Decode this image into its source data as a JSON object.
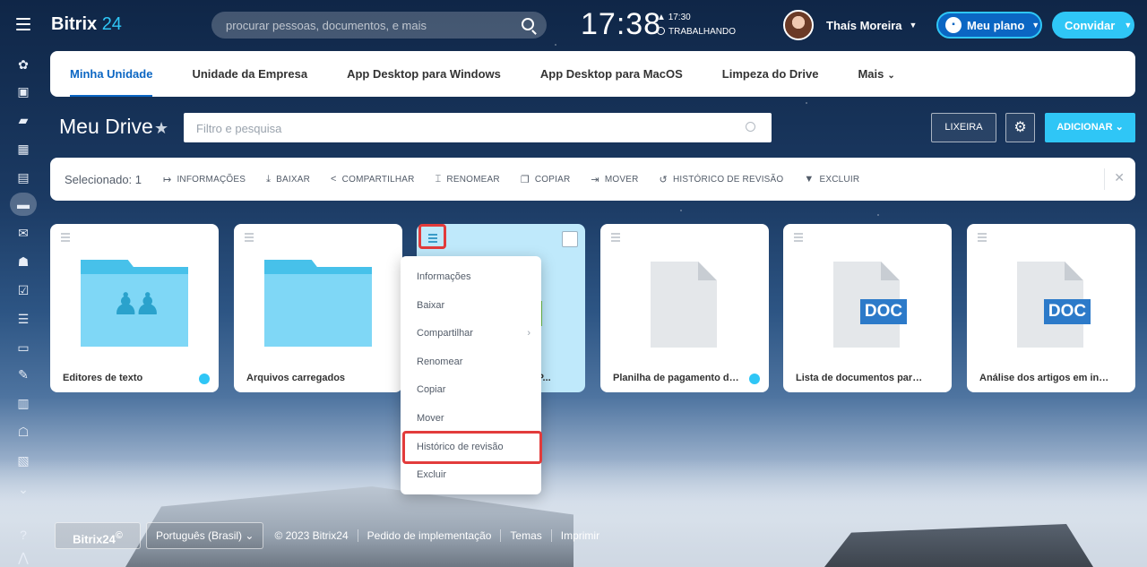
{
  "header": {
    "logo_text": "Bitrix",
    "logo_num": "24",
    "search_placeholder": "procurar pessoas, documentos, e mais",
    "time": "17:38",
    "time_small": "17:30",
    "status": "TRABALHANDO",
    "user_name": "Thaís Moreira",
    "plan_label": "Meu plano",
    "invite_label": "Convidar"
  },
  "tabs": [
    {
      "label": "Minha Unidade",
      "active": true
    },
    {
      "label": "Unidade da Empresa"
    },
    {
      "label": "App Desktop para Windows"
    },
    {
      "label": "App Desktop para MacOS"
    },
    {
      "label": "Limpeza do Drive"
    },
    {
      "label": "Mais"
    }
  ],
  "drive": {
    "title": "Meu Drive",
    "filter_placeholder": "Filtro e pesquisa",
    "trash_label": "LIXEIRA",
    "add_label": "ADICIONAR"
  },
  "actionbar": {
    "selected": "Selecionado: 1",
    "actions": [
      "INFORMAÇÕES",
      "BAIXAR",
      "COMPARTILHAR",
      "RENOMEAR",
      "COPIAR",
      "MOVER",
      "HISTÓRICO DE REVISÃO",
      "EXCLUIR"
    ]
  },
  "tiles": [
    {
      "title": "Editores de texto",
      "type": "shared-folder"
    },
    {
      "title": "Arquivos carregados",
      "type": "folder"
    },
    {
      "title": "ão - P...",
      "type": "selected"
    },
    {
      "title": "Planilha de pagamento de ou...",
      "type": "file"
    },
    {
      "title": "Lista de documentos para audito...",
      "type": "doc",
      "badge": "DOC"
    },
    {
      "title": "Análise dos artigos em inglês.docx",
      "type": "doc",
      "badge": "DOC"
    }
  ],
  "context_menu": [
    "Informações",
    "Baixar",
    "Compartilhar",
    "Renomear",
    "Copiar",
    "Mover",
    "Histórico de revisão",
    "Excluir"
  ],
  "footer": {
    "brand": "Bitrix24",
    "brand_mark": "©",
    "language": "Português (Brasil)",
    "copyright": "© 2023 Bitrix24",
    "implementation": "Pedido de implementação",
    "themes": "Temas",
    "print": "Imprimir"
  },
  "colors": {
    "accent": "#2fc6f6",
    "link_blue": "#0b66c3",
    "highlight_red": "#e23b3b"
  }
}
